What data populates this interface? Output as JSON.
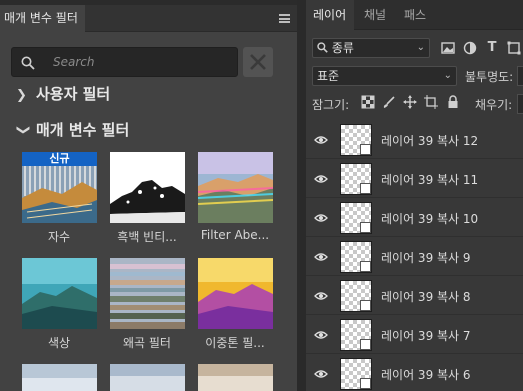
{
  "left_panel": {
    "tab_label": "매개 변수 필터",
    "search_placeholder": "Search",
    "sections": {
      "user": "사용자 필터",
      "neural": "매개 변수 필터"
    },
    "new_badge": "신규",
    "filters": [
      {
        "label": "자수"
      },
      {
        "label": "흑백 빈티..."
      },
      {
        "label": "Filter Abe..."
      },
      {
        "label": "색상"
      },
      {
        "label": "왜곡 필터"
      },
      {
        "label": "이중톤 필..."
      }
    ]
  },
  "layers_panel": {
    "tabs": [
      "레이어",
      "채널",
      "패스"
    ],
    "kind_filter": "종류",
    "blend_mode": "표준",
    "opacity_label": "불투명도:",
    "lock_label": "잠그기:",
    "fill_label": "채우기:",
    "layers": [
      {
        "name": "레이어 39 복사 12"
      },
      {
        "name": "레이어 39 복사 11"
      },
      {
        "name": "레이어 39 복사 10"
      },
      {
        "name": "레이어 39 복사 9"
      },
      {
        "name": "레이어 39 복사 8"
      },
      {
        "name": "레이어 39 복사 7"
      },
      {
        "name": "레이어 39 복사 6"
      }
    ]
  }
}
